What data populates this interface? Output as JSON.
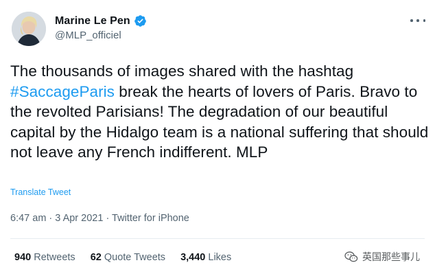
{
  "author": {
    "display_name": "Marine Le Pen",
    "handle": "@MLP_officiel",
    "verified_icon": "verified-badge-icon"
  },
  "tweet": {
    "text_before": "The thousands of images shared with the hashtag ",
    "hashtag": "#SaccageParis",
    "text_after": " break the hearts of lovers of Paris. Bravo to the revolted Parisians! The degradation of our beautiful capital by the Hidalgo team is a national suffering that should not leave any French indifferent. MLP",
    "translate_label": "Translate Tweet",
    "timestamp": "6:47 am · 3 Apr 2021 · Twitter for iPhone"
  },
  "stats": {
    "retweets_count": "940",
    "retweets_label": "Retweets",
    "quotes_count": "62",
    "quotes_label": "Quote Tweets",
    "likes_count": "3,440",
    "likes_label": "Likes"
  },
  "watermark": {
    "text": "英国那些事儿"
  },
  "colors": {
    "accent": "#1d9bf0",
    "text_primary": "#0f1419",
    "text_secondary": "#536471",
    "divider": "#e6ecf0"
  }
}
